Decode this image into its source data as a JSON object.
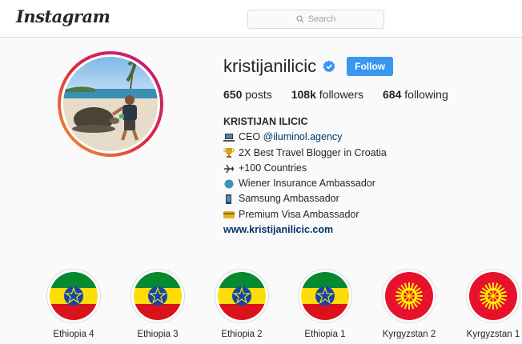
{
  "header": {
    "logo_text": "Instagram",
    "search_placeholder": "Search"
  },
  "profile": {
    "username": "kristijanilicic",
    "verified": true,
    "follow_label": "Follow",
    "posts_count": "650",
    "posts_label": "posts",
    "followers_count": "108k",
    "followers_label": "followers",
    "following_count": "684",
    "following_label": "following"
  },
  "bio": {
    "name": "KRISTIJAN ILICIC",
    "line1_prefix": "CEO ",
    "line1_mention": "@iluminol.agency",
    "line2": "2X Best Travel Blogger in Croatia",
    "line3": "+100 Countries",
    "line4": "Wiener Insurance Ambassador",
    "line5": "Samsung Ambassador",
    "line6": "Premium Visa Ambassador",
    "website": "www.kristijanilicic.com"
  },
  "highlights": [
    {
      "label": "Ethiopia 4",
      "flag": "ethiopia"
    },
    {
      "label": "Ethiopia 3",
      "flag": "ethiopia"
    },
    {
      "label": "Ethiopia 2",
      "flag": "ethiopia"
    },
    {
      "label": "Ethiopia 1",
      "flag": "ethiopia"
    },
    {
      "label": "Kyrgyzstan 2",
      "flag": "kyrgyzstan"
    },
    {
      "label": "Kyrgyzstan 1",
      "flag": "kyrgyzstan"
    }
  ],
  "colors": {
    "follow_button": "#3897f0",
    "link": "#003569",
    "verified_badge": "#3897f0"
  }
}
